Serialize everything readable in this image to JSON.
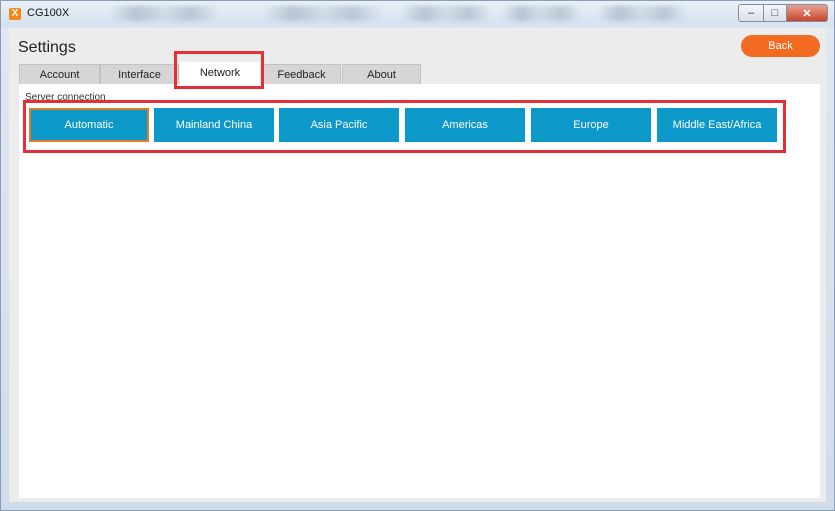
{
  "window": {
    "app_icon_glyph": "X",
    "title": "CG100X",
    "controls": {
      "minimize": "–",
      "maximize": "□",
      "close": "✕"
    }
  },
  "header": {
    "title": "Settings",
    "back_label": "Back"
  },
  "tabs": [
    {
      "label": "Account"
    },
    {
      "label": "Interface"
    },
    {
      "label": "Network"
    },
    {
      "label": "Feedback"
    },
    {
      "label": "About"
    }
  ],
  "active_tab": "Network",
  "network": {
    "section_label": "Server connection",
    "options": [
      {
        "label": "Automatic"
      },
      {
        "label": "Mainland China"
      },
      {
        "label": "Asia Pacific"
      },
      {
        "label": "Americas"
      },
      {
        "label": "Europe"
      },
      {
        "label": "Middle East/Africa"
      }
    ],
    "selected": "Automatic"
  },
  "colors": {
    "accent_orange": "#f26b21",
    "server_button_blue": "#0c98c9",
    "highlight_red": "#e33037",
    "selected_border": "#e67a24"
  }
}
